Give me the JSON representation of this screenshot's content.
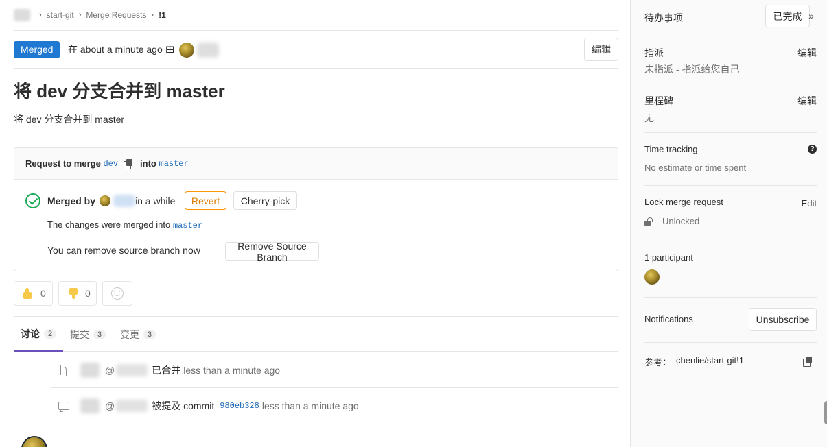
{
  "breadcrumb": {
    "project": "start-git",
    "section": "Merge Requests",
    "current": "!1"
  },
  "status": {
    "badge": "Merged",
    "prefix": "在 about a minute ago 由",
    "edit_label": "编辑"
  },
  "title": "将 dev 分支合并到 master",
  "description": "将 dev 分支合并到 master",
  "widget": {
    "request_prefix": "Request to merge",
    "source_branch": "dev",
    "into_label": "into",
    "target_branch": "master",
    "merged_by_label": "Merged by",
    "merged_when": "in a while",
    "revert_label": "Revert",
    "cherry_pick_label": "Cherry-pick",
    "merged_into_text": "The changes were merged into",
    "merged_into_branch": "master",
    "remove_text": "You can remove source branch now",
    "remove_button": "Remove Source Branch"
  },
  "awards": {
    "thumbs_up_count": "0",
    "thumbs_down_count": "0"
  },
  "tabs": [
    {
      "label": "讨论",
      "count": "2"
    },
    {
      "label": "提交",
      "count": "3"
    },
    {
      "label": "变更",
      "count": "3"
    }
  ],
  "notes": [
    {
      "prefix": "@",
      "action": "已合并",
      "time": "less than a minute ago"
    },
    {
      "prefix": "@",
      "action": "被提及 commit",
      "sha": "980eb328",
      "time": "less than a minute ago"
    }
  ],
  "sidebar": {
    "todo_title": "待办事项",
    "todo_button": "已完成",
    "collapse_glyph": "»",
    "assignee_title": "指派",
    "assignee_edit": "编辑",
    "assignee_value": "未指派 - 指派给您自己",
    "milestone_title": "里程碑",
    "milestone_edit": "编辑",
    "milestone_value": "无",
    "time_title": "Time tracking",
    "time_value": "No estimate or time spent",
    "help_glyph": "?",
    "lock_title": "Lock merge request",
    "lock_edit": "Edit",
    "lock_value": "Unlocked",
    "participants_title": "1 participant",
    "notifications_title": "Notifications",
    "unsubscribe_label": "Unsubscribe",
    "reference_label": "参考：",
    "reference_value": "chenlie/start-git!1"
  },
  "colors": {
    "badge_blue": "#1f78d1",
    "merged_green": "#1aaa55",
    "revert_orange": "#fc9403",
    "active_tab": "#6b4fbb",
    "link_blue": "#1b69b6"
  },
  "icons": [
    "chevron-right-icon",
    "copy-icon",
    "check-circle-icon",
    "thumbs-up-icon",
    "thumbs-down-icon",
    "smiley-icon",
    "merge-icon",
    "comment-icon",
    "question-icon",
    "lock-open-icon",
    "double-chevron-icon"
  ]
}
